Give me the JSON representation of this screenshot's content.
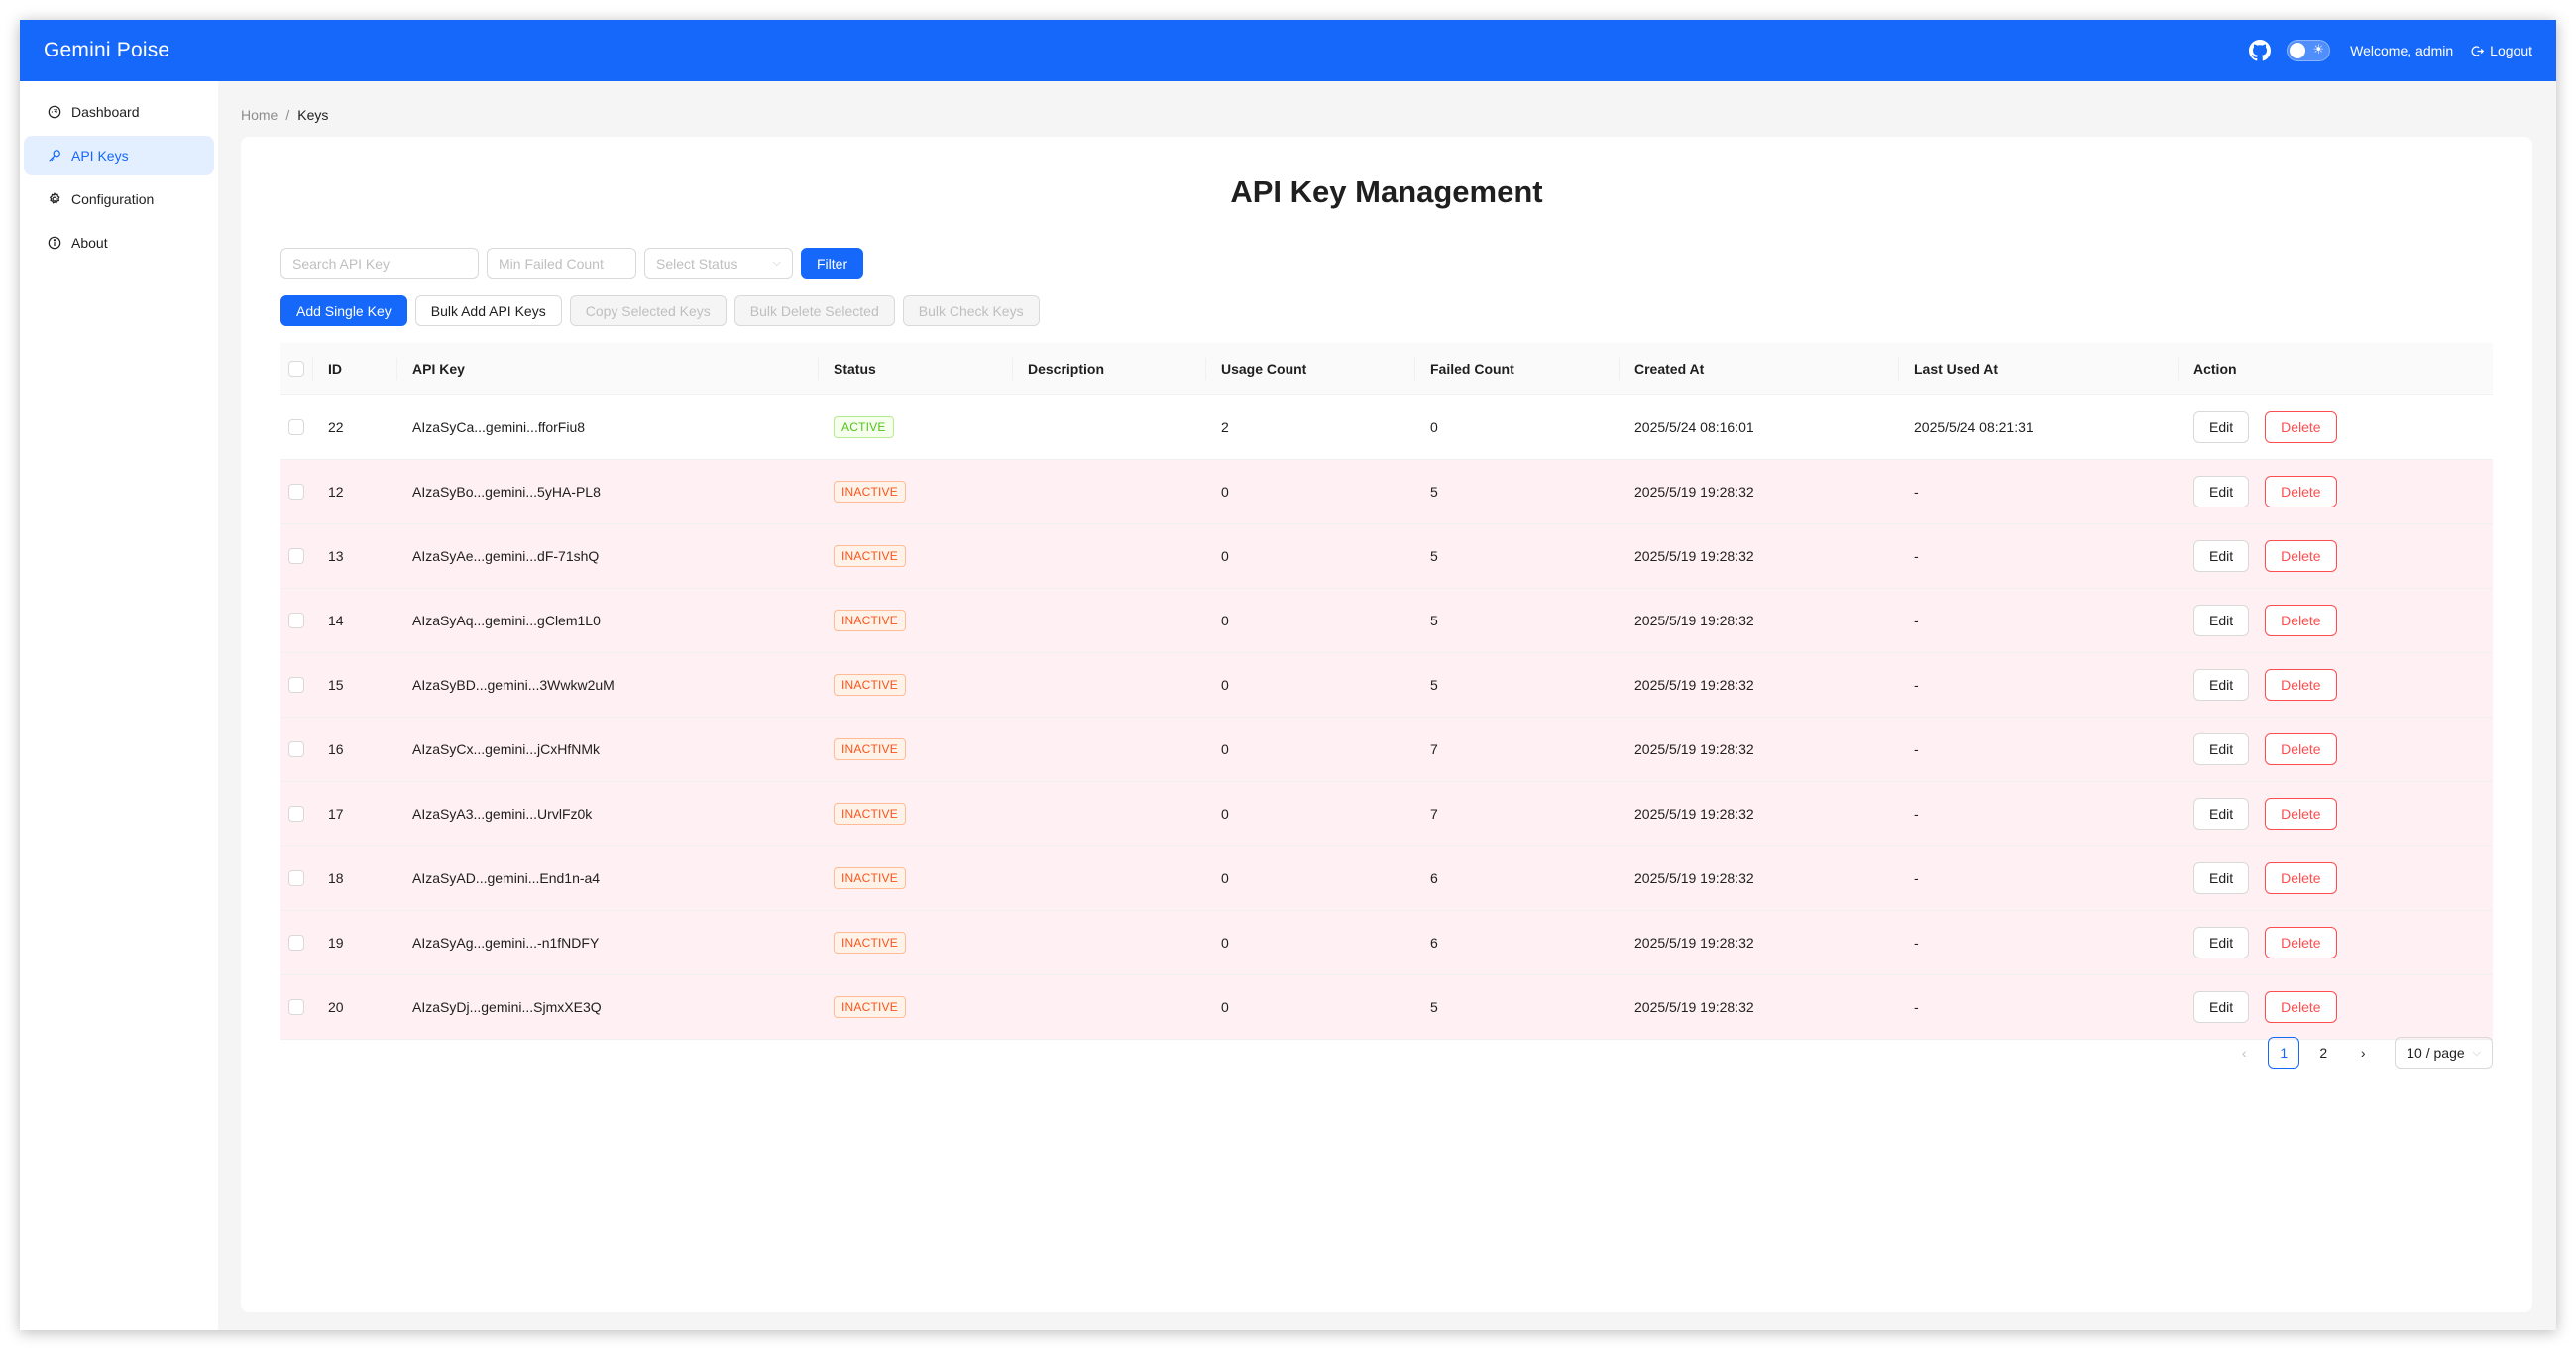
{
  "app": {
    "brand": "Gemini Poise",
    "welcome": "Welcome, admin",
    "logout": "Logout",
    "accent": "#1668fa"
  },
  "sidebar": {
    "items": [
      {
        "label": "Dashboard",
        "icon": "dashboard-icon"
      },
      {
        "label": "API Keys",
        "icon": "key-icon",
        "active": true
      },
      {
        "label": "Configuration",
        "icon": "gear-icon"
      },
      {
        "label": "About",
        "icon": "info-icon"
      }
    ]
  },
  "breadcrumb": {
    "home": "Home",
    "separator": "/",
    "current": "Keys"
  },
  "page": {
    "title": "API Key Management"
  },
  "filters": {
    "search_placeholder": "Search API Key",
    "min_failed_placeholder": "Min Failed Count",
    "status_placeholder": "Select Status",
    "filter_button": "Filter"
  },
  "toolbar": {
    "add_single": "Add Single Key",
    "bulk_add": "Bulk Add API Keys",
    "copy_selected": "Copy Selected Keys",
    "bulk_delete": "Bulk Delete Selected",
    "bulk_check": "Bulk Check Keys"
  },
  "table": {
    "columns": [
      "ID",
      "API Key",
      "Status",
      "Description",
      "Usage Count",
      "Failed Count",
      "Created At",
      "Last Used At",
      "Action"
    ],
    "edit_label": "Edit",
    "delete_label": "Delete",
    "rows": [
      {
        "id": "22",
        "key": "AIzaSyCa...gemini...fforFiu8",
        "status": "ACTIVE",
        "description": "",
        "usage": "2",
        "failed": "0",
        "created": "2025/5/24 08:16:01",
        "last_used": "2025/5/24 08:21:31"
      },
      {
        "id": "12",
        "key": "AIzaSyBo...gemini...5yHA-PL8",
        "status": "INACTIVE",
        "description": "",
        "usage": "0",
        "failed": "5",
        "created": "2025/5/19 19:28:32",
        "last_used": "-"
      },
      {
        "id": "13",
        "key": "AIzaSyAe...gemini...dF-71shQ",
        "status": "INACTIVE",
        "description": "",
        "usage": "0",
        "failed": "5",
        "created": "2025/5/19 19:28:32",
        "last_used": "-"
      },
      {
        "id": "14",
        "key": "AIzaSyAq...gemini...gClem1L0",
        "status": "INACTIVE",
        "description": "",
        "usage": "0",
        "failed": "5",
        "created": "2025/5/19 19:28:32",
        "last_used": "-"
      },
      {
        "id": "15",
        "key": "AIzaSyBD...gemini...3Wwkw2uM",
        "status": "INACTIVE",
        "description": "",
        "usage": "0",
        "failed": "5",
        "created": "2025/5/19 19:28:32",
        "last_used": "-"
      },
      {
        "id": "16",
        "key": "AIzaSyCx...gemini...jCxHfNMk",
        "status": "INACTIVE",
        "description": "",
        "usage": "0",
        "failed": "7",
        "created": "2025/5/19 19:28:32",
        "last_used": "-"
      },
      {
        "id": "17",
        "key": "AIzaSyA3...gemini...UrvlFz0k",
        "status": "INACTIVE",
        "description": "",
        "usage": "0",
        "failed": "7",
        "created": "2025/5/19 19:28:32",
        "last_used": "-"
      },
      {
        "id": "18",
        "key": "AIzaSyAD...gemini...End1n-a4",
        "status": "INACTIVE",
        "description": "",
        "usage": "0",
        "failed": "6",
        "created": "2025/5/19 19:28:32",
        "last_used": "-"
      },
      {
        "id": "19",
        "key": "AIzaSyAg...gemini...-n1fNDFY",
        "status": "INACTIVE",
        "description": "",
        "usage": "0",
        "failed": "6",
        "created": "2025/5/19 19:28:32",
        "last_used": "-"
      },
      {
        "id": "20",
        "key": "AIzaSyDj...gemini...SjmxXE3Q",
        "status": "INACTIVE",
        "description": "",
        "usage": "0",
        "failed": "5",
        "created": "2025/5/19 19:28:32",
        "last_used": "-"
      }
    ]
  },
  "pagination": {
    "pages": [
      "1",
      "2"
    ],
    "current": "1",
    "page_size": "10 / page"
  }
}
